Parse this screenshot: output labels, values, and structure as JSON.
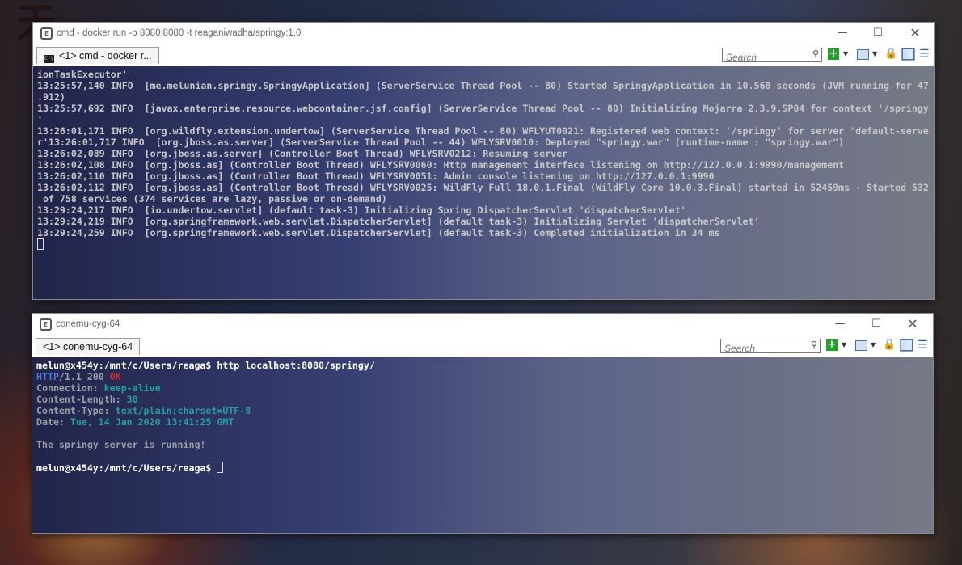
{
  "windows": [
    {
      "title": "cmd - docker  run -p 8080:8080 -t reaganiwadha/springy:1.0",
      "tab_label": "<1> cmd - docker  r...",
      "search_placeholder": "Search",
      "console_lines": [
        "ionTaskExecutor'",
        "13:25:57,140 INFO  [me.melunian.springy.SpringyApplication] (ServerService Thread Pool -- 80) Started SpringyApplication in 10.568 seconds (JVM running for 47",
        ".912)",
        "13:25:57,692 INFO  [javax.enterprise.resource.webcontainer.jsf.config] (ServerService Thread Pool -- 80) Initializing Mojarra 2.3.9.SP04 for context '/springy",
        "'",
        "13:26:01,171 INFO  [org.wildfly.extension.undertow] (ServerService Thread Pool -- 80) WFLYUT0021: Registered web context: '/springy' for server 'default-serve",
        "r'13:26:01,717 INFO  [org.jboss.as.server] (ServerService Thread Pool -- 44) WFLYSRV0010: Deployed \"springy.war\" (runtime-name : \"springy.war\")",
        "13:26:02,089 INFO  [org.jboss.as.server] (Controller Boot Thread) WFLYSRV0212: Resuming server",
        "13:26:02,108 INFO  [org.jboss.as] (Controller Boot Thread) WFLYSRV0060: Http management interface listening on http://127.0.0.1:9990/management",
        "13:26:02,110 INFO  [org.jboss.as] (Controller Boot Thread) WFLYSRV0051: Admin console listening on http://127.0.0.1:9990",
        "13:26:02,112 INFO  [org.jboss.as] (Controller Boot Thread) WFLYSRV0025: WildFly Full 18.0.1.Final (WildFly Core 10.0.3.Final) started in 52459ms - Started 532",
        " of 758 services (374 services are lazy, passive or on-demand)",
        "13:29:24,217 INFO  [io.undertow.servlet] (default task-3) Initializing Spring DispatcherServlet 'dispatcherServlet'",
        "13:29:24,219 INFO  [org.springframework.web.servlet.DispatcherServlet] (default task-3) Initializing Servlet 'dispatcherServlet'",
        "13:29:24,259 INFO  [org.springframework.web.servlet.DispatcherServlet] (default task-3) Completed initialization in 34 ms"
      ]
    },
    {
      "title": "conemu-cyg-64",
      "tab_label": "<1> conemu-cyg-64",
      "search_placeholder": "Search",
      "prompt": "melun@x454y:/mnt/c/Users/reaga$",
      "command": " http localhost:8080/springy/",
      "http_proto": "HTTP",
      "http_version": "/1.1 200 ",
      "http_status": "OK",
      "headers": [
        {
          "name": "Connection:",
          "value": " keep-alive"
        },
        {
          "name": "Content-Length:",
          "value": " 30"
        },
        {
          "name": "Content-Type:",
          "value": " text/plain;charset=UTF-8"
        },
        {
          "name": "Date:",
          "value": " Tue, 14 Jan 2020 13:41:25 GMT"
        }
      ],
      "body": "The springy server is running!",
      "prompt2": "melun@x454y:/mnt/c/Users/reaga$"
    }
  ],
  "icons": {
    "minimize": "minimize-icon",
    "maximize": "maximize-icon",
    "close": "close-icon",
    "search": "search-icon"
  },
  "colors": {
    "status_ok": "#d12a2a",
    "proto": "#4b7bd6",
    "header_value": "#23a0a0",
    "add_button": "#22a32a"
  }
}
